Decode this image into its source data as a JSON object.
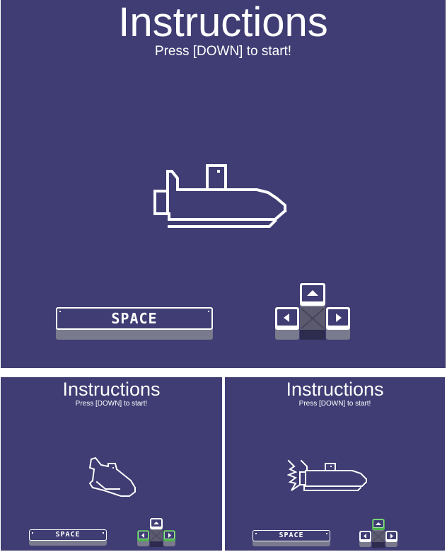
{
  "screens": [
    {
      "title": "Instructions",
      "subtitle": "Press [DOWN] to start!",
      "space_label": "SPACE",
      "sprite": "submarine",
      "highlighted_keys": []
    },
    {
      "title": "Instructions",
      "subtitle": "Press [DOWN] to start!",
      "space_label": "SPACE",
      "sprite": "submarine-tilted",
      "highlighted_keys": [
        "left",
        "right"
      ]
    },
    {
      "title": "Instructions",
      "subtitle": "Press [DOWN] to start!",
      "space_label": "SPACE",
      "sprite": "submarine-boosting",
      "highlighted_keys": [
        "up"
      ]
    }
  ],
  "colors": {
    "background": "#3f3d73",
    "foreground": "#ffffff",
    "key_shadow": "#7a7a8e",
    "down_key": "#5b5a6e",
    "down_key_dark": "#2d2b4e",
    "highlight": "#4cb54c"
  },
  "icons": {
    "up": "up-arrow-icon",
    "left": "left-arrow-icon",
    "right": "right-arrow-icon",
    "down": "cross-x-icon"
  }
}
